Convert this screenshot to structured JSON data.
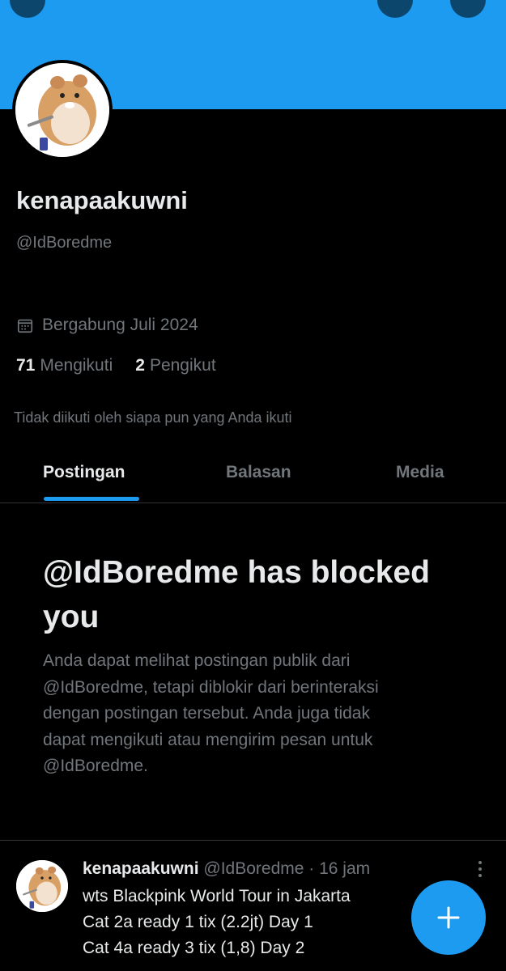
{
  "colors": {
    "accent": "#1d9bf0",
    "background": "#000000",
    "text_primary": "#e7e9ea",
    "text_secondary": "#71767b"
  },
  "profile": {
    "display_name": "kenapaakuwni",
    "handle": "@IdBoredme",
    "joined": "Bergabung Juli 2024",
    "following_count": "71",
    "following_label": "Mengikuti",
    "followers_count": "2",
    "followers_label": "Pengikut",
    "not_followed_by": "Tidak diikuti oleh siapa pun yang Anda ikuti"
  },
  "tabs": [
    {
      "label": "Postingan",
      "active": true
    },
    {
      "label": "Balasan",
      "active": false
    },
    {
      "label": "Media",
      "active": false
    }
  ],
  "blocked": {
    "title_line1": "@IdBoredme has blocked",
    "title_line2": "you",
    "body_lines": [
      "Anda dapat melihat postingan publik dari",
      "@IdBoredme, tetapi diblokir dari berinteraksi",
      "dengan postingan tersebut. Anda juga tidak",
      "dapat mengikuti atau mengirim pesan untuk",
      "@IdBoredme."
    ]
  },
  "post": {
    "name": "kenapaakuwni",
    "meta": "@IdBoredme · 16 jam",
    "lines": [
      "wts Blackpink World Tour in Jakarta",
      "Cat 2a ready 1 tix (2.2jt) Day 1",
      "Cat 4a ready 3 tix (1,8) Day 2"
    ]
  },
  "icons": {
    "calendar": "calendar-icon",
    "compose": "plus-icon",
    "more": "more-vertical-icon",
    "avatar": "hamster-avatar"
  }
}
